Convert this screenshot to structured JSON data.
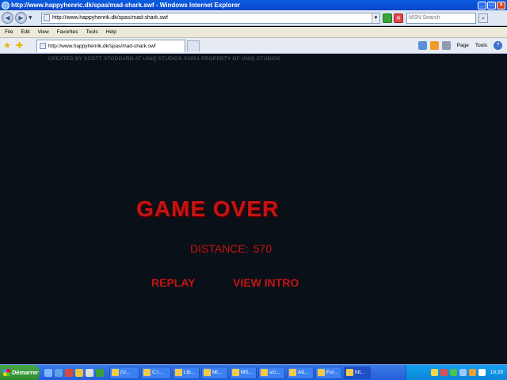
{
  "window": {
    "title": "http://www.happyhenric.dk/spas/mad-shark.swf - Windows Internet Explorer"
  },
  "address_bar": {
    "url": "http://www.happyhenrik.dk/spas/mad-shark.swf",
    "search_placeholder": "MSN Search"
  },
  "menu": {
    "items": [
      "File",
      "Edit",
      "View",
      "Favorites",
      "Tools",
      "Help"
    ]
  },
  "tab": {
    "label": "http://www.happyhenrik.dk/spas/mad-shark.swf"
  },
  "toolbar": {
    "page_label": "Page",
    "tools_label": "Tools",
    "help_glyph": "?"
  },
  "game": {
    "credits": "CREATED BY SCOTT STODDARD AT UNIQ STUDIOS ©2001 PROPERTY OF UNIQ STUDIOS",
    "gameover": "GAME OVER",
    "distance_label": "DISTANCE:",
    "distance_value": "570",
    "replay_label": "REPLAY",
    "intro_label": "VIEW INTRO",
    "accent_color": "#c41414"
  },
  "taskbar": {
    "start_label": "Démarrer",
    "tasks": [
      "(U...",
      "C:\\...",
      "Lib...",
      "Ml...",
      "MS...",
      "sc\\...",
      "Att...",
      "For...",
      "htt..."
    ],
    "clock": "19:29"
  }
}
